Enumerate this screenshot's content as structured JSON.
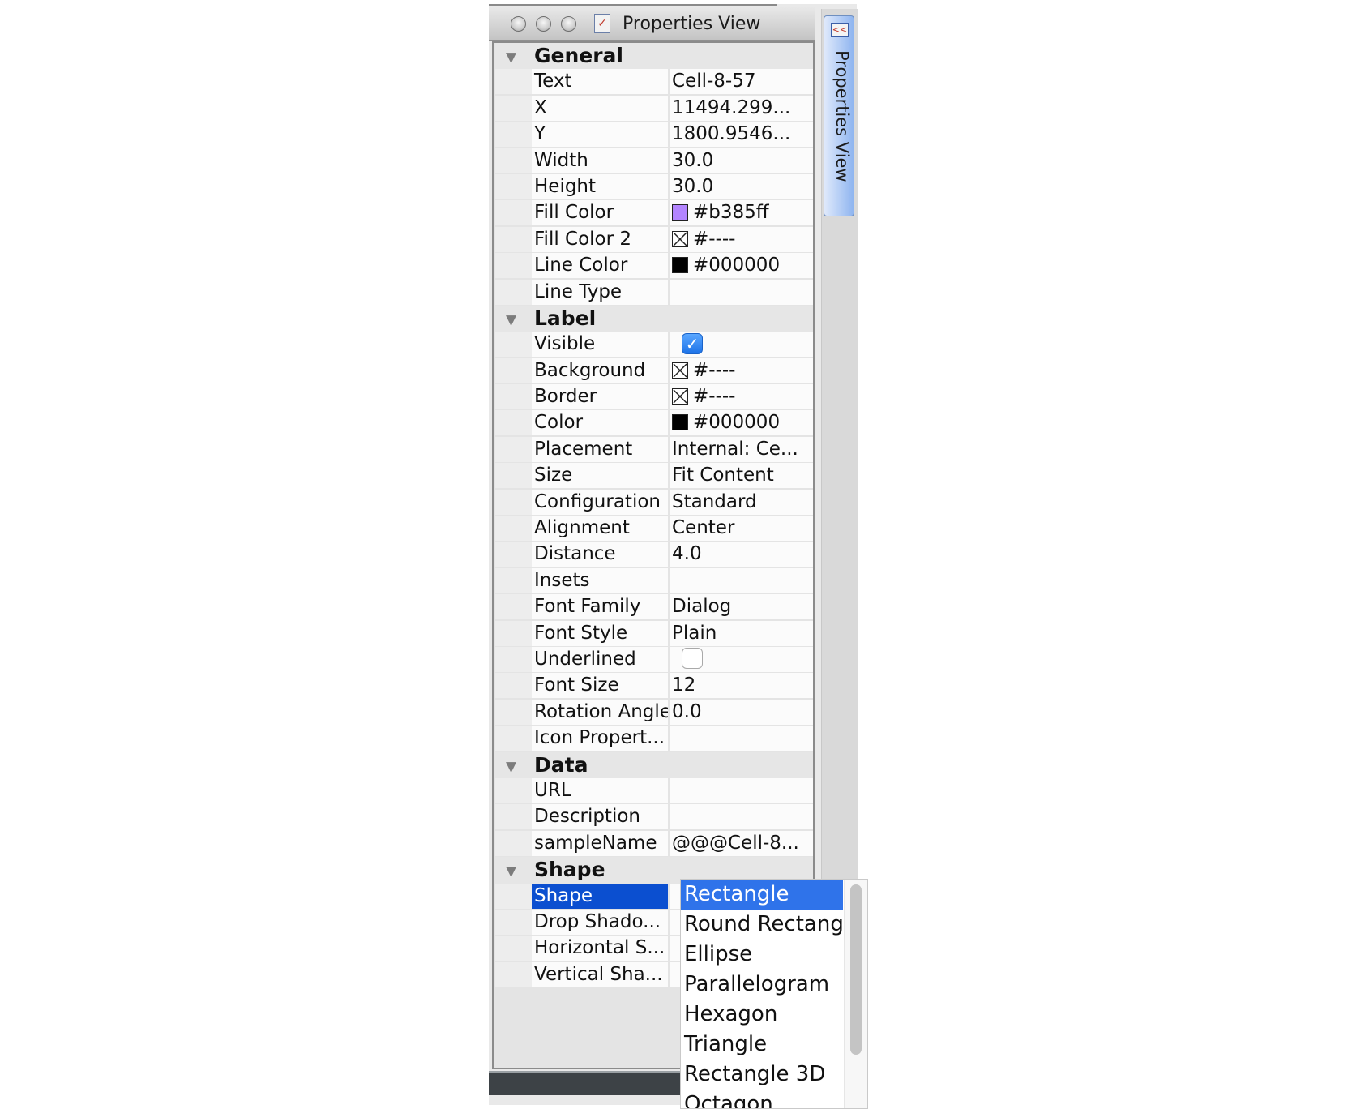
{
  "window": {
    "title": "Properties View"
  },
  "sidebar": {
    "tab_label": "Properties View"
  },
  "sections": [
    {
      "title": "General",
      "rows": [
        {
          "name": "Text",
          "value": "Cell-8-57"
        },
        {
          "name": "X",
          "value": "11494.299..."
        },
        {
          "name": "Y",
          "value": "1800.9546..."
        },
        {
          "name": "Width",
          "value": "30.0"
        },
        {
          "name": "Height",
          "value": "30.0"
        },
        {
          "name": "Fill Color",
          "value": "#b385ff",
          "kind": "color",
          "swatch": "#b385ff"
        },
        {
          "name": "Fill Color 2",
          "value": "#----",
          "kind": "none-color"
        },
        {
          "name": "Line Color",
          "value": "#000000",
          "kind": "color",
          "swatch": "#000000"
        },
        {
          "name": "Line Type",
          "value": "",
          "kind": "line"
        }
      ]
    },
    {
      "title": "Label",
      "rows": [
        {
          "name": "Visible",
          "value": "",
          "kind": "checkbox",
          "checked": true
        },
        {
          "name": "Background",
          "value": "#----",
          "kind": "none-color"
        },
        {
          "name": "Border",
          "value": "#----",
          "kind": "none-color"
        },
        {
          "name": "Color",
          "value": "#000000",
          "kind": "color",
          "swatch": "#000000"
        },
        {
          "name": "Placement",
          "value": "Internal: Ce..."
        },
        {
          "name": "Size",
          "value": "Fit Content"
        },
        {
          "name": "Configuration",
          "value": "Standard"
        },
        {
          "name": "Alignment",
          "value": "Center"
        },
        {
          "name": "Distance",
          "value": "4.0"
        },
        {
          "name": "Insets",
          "value": ""
        },
        {
          "name": "Font Family",
          "value": "Dialog"
        },
        {
          "name": "Font Style",
          "value": "Plain"
        },
        {
          "name": "Underlined",
          "value": "",
          "kind": "checkbox",
          "checked": false
        },
        {
          "name": "Font Size",
          "value": "12"
        },
        {
          "name": "Rotation Angle",
          "value": "0.0"
        },
        {
          "name": "Icon Propert...",
          "value": ""
        }
      ]
    },
    {
      "title": "Data",
      "rows": [
        {
          "name": "URL",
          "value": ""
        },
        {
          "name": "Description",
          "value": ""
        },
        {
          "name": "sampleName",
          "value": "@@@Cell-8..."
        }
      ]
    },
    {
      "title": "Shape",
      "rows": [
        {
          "name": "Shape",
          "value": "",
          "selected": true
        },
        {
          "name": "Drop Shado...",
          "value": ""
        },
        {
          "name": "Horizontal S...",
          "value": ""
        },
        {
          "name": "Vertical Sha...",
          "value": ""
        }
      ]
    }
  ],
  "shape_dropdown": {
    "selected": "Rectangle",
    "options": [
      "Rectangle",
      "Round Rectangle",
      "Ellipse",
      "Parallelogram",
      "Hexagon",
      "Triangle",
      "Rectangle 3D",
      "Octagon"
    ]
  },
  "colors": {
    "selection": "#0b4fd0",
    "dropdown_selection": "#2f73ea",
    "checkbox_on": "#1d73e8"
  }
}
